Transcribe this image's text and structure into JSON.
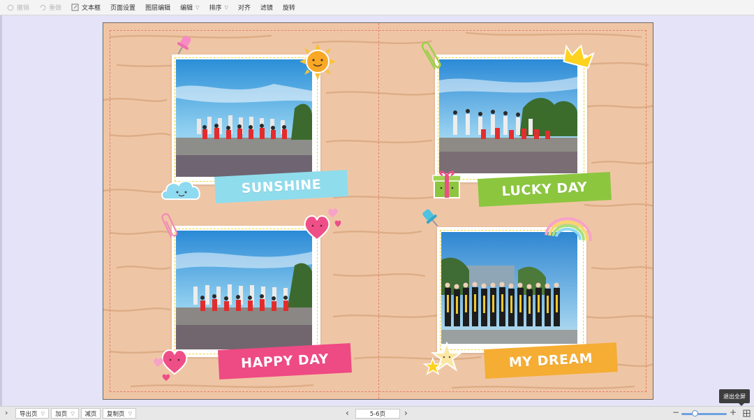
{
  "toolbar": {
    "undo": "撤销",
    "redo": "重做",
    "textbox": "文本框",
    "page_settings": "页面设置",
    "layer_edit": "图层编辑",
    "edit": "编辑",
    "arrange": "排序",
    "align": "对齐",
    "filter": "滤镜",
    "rotate": "旋转"
  },
  "album": {
    "captions": [
      "SUNSHINE",
      "LUCKY DAY",
      "HAPPY DAY",
      "MY DREAM"
    ],
    "caption_colors": [
      "#8fdcec",
      "#8cc63f",
      "#ee4a83",
      "#f5ad33"
    ]
  },
  "bottombar": {
    "export_page": "导出页",
    "add_page": "加页",
    "reduce_page": "减页",
    "copy_page": "复制页",
    "page_indicator": "5-6页",
    "tooltip": "退出全屏"
  },
  "zoom": {
    "level_fraction": 0.3
  }
}
